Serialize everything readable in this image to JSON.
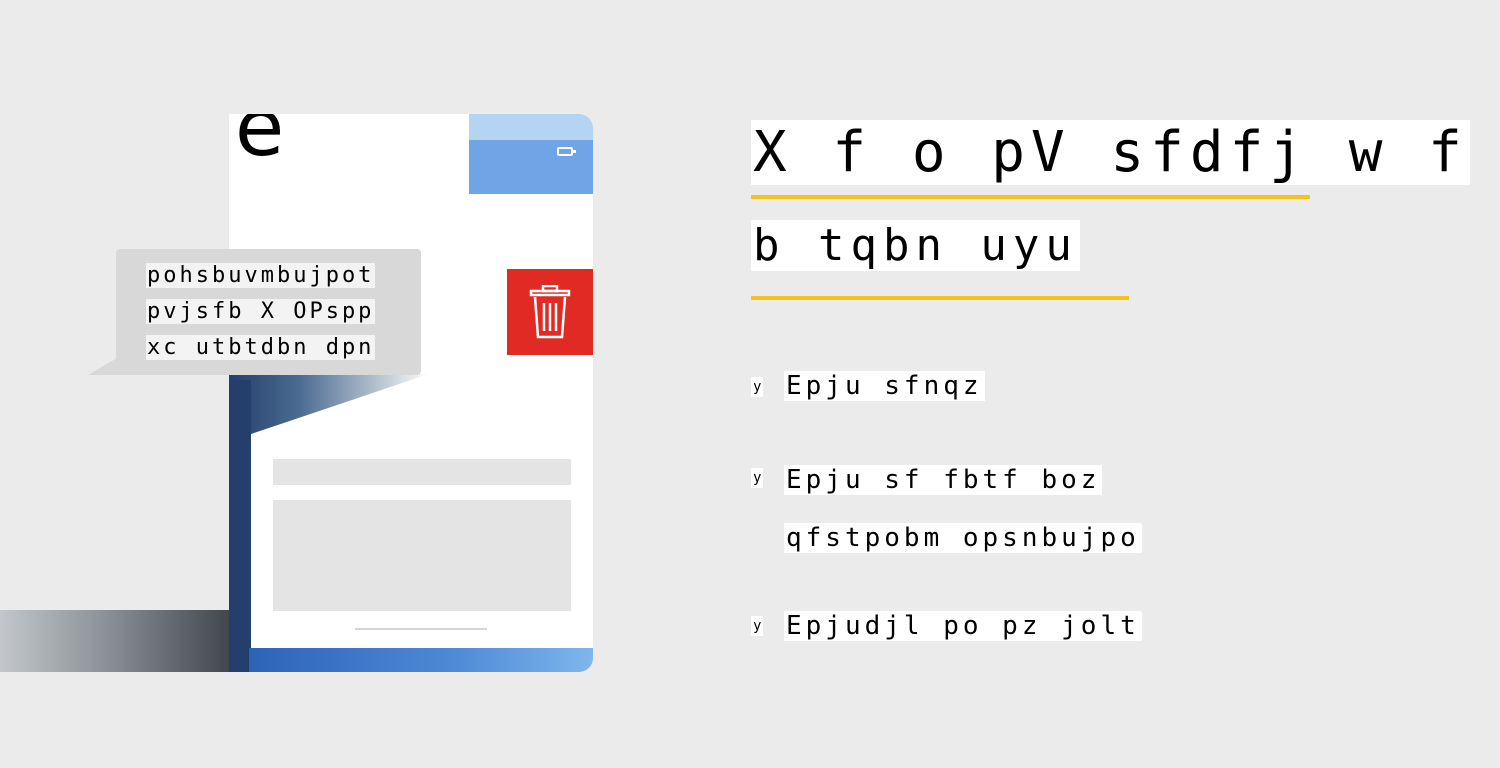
{
  "phone": {
    "corner_glyph": "e",
    "icons": [
      "battery-icon",
      "trash-icon"
    ],
    "colors": {
      "header_light": "#b4d5f1",
      "header_blue": "#6fa5e6",
      "delete_red": "#e12a23",
      "body_dark": "#243f6c"
    }
  },
  "bubble": {
    "line1": "pohsbuvmbujpot",
    "line2": "pvjsfb X OPspp",
    "line3": "xc utbtdbn dpn"
  },
  "heading": {
    "line1": "X f o pV sfdfj w f",
    "line2": "b tqbn uyu",
    "underline_color": "#f5c21b"
  },
  "list": {
    "bullet": "y",
    "item1": "Epju sfnqz",
    "item2_line1": "Epju sf fbtf boz",
    "item2_line2": "qfstpobm opsnbujpo",
    "item3": "Epjudjl po pz jolt"
  }
}
